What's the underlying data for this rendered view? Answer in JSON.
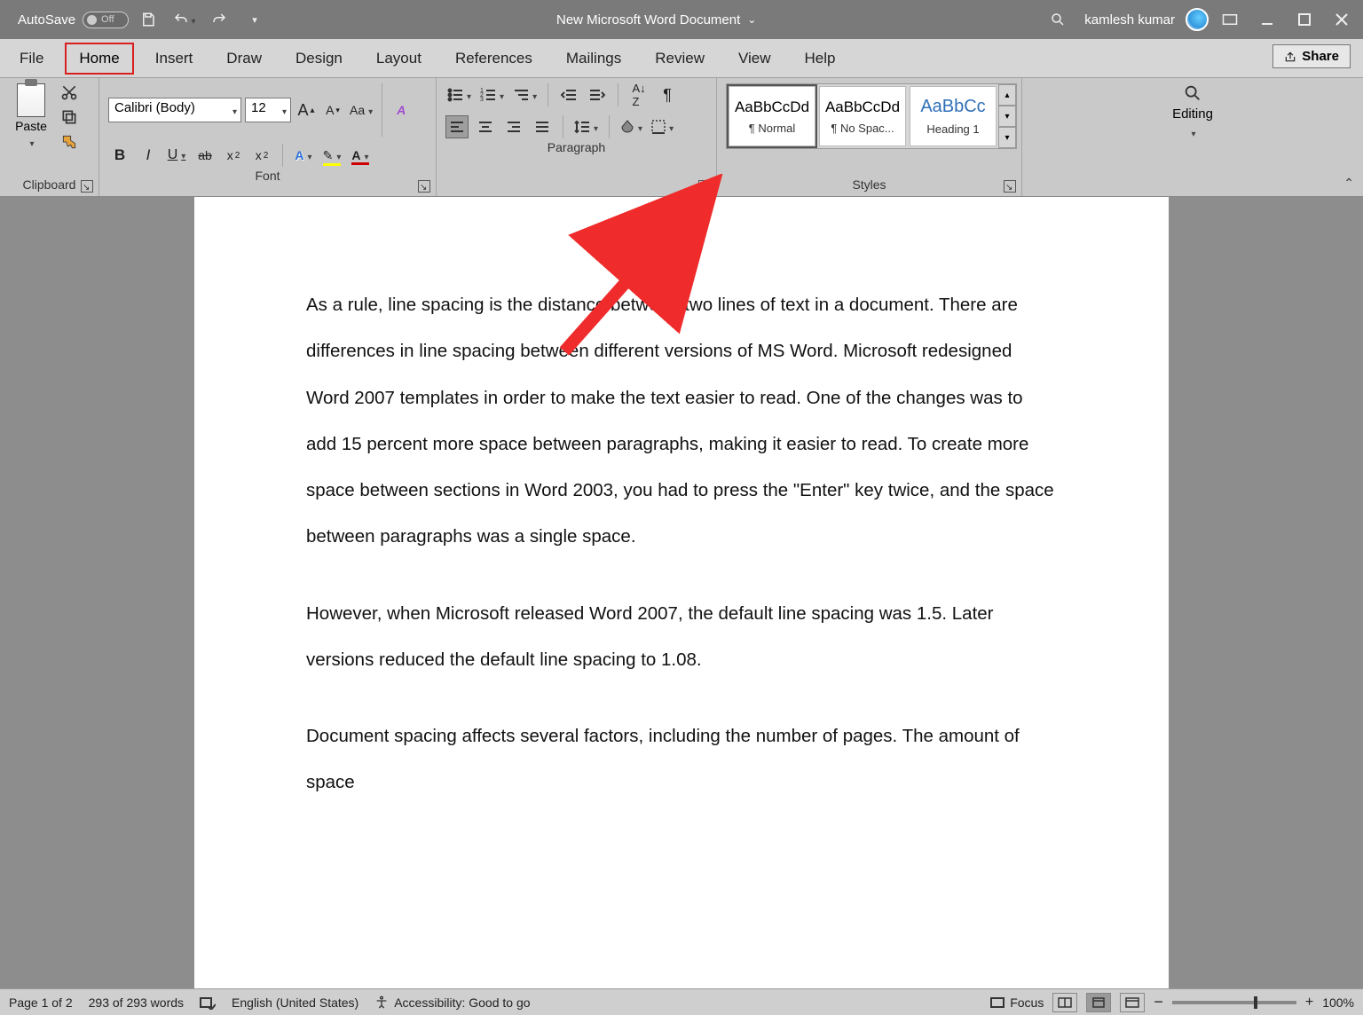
{
  "titleBar": {
    "autosave_label": "AutoSave",
    "autosave_state": "Off",
    "doc_title": "New Microsoft Word Document",
    "user_name": "kamlesh kumar"
  },
  "tabs": {
    "file": "File",
    "home": "Home",
    "insert": "Insert",
    "draw": "Draw",
    "design": "Design",
    "layout": "Layout",
    "references": "References",
    "mailings": "Mailings",
    "review": "Review",
    "view": "View",
    "help": "Help",
    "share": "Share"
  },
  "ribbon": {
    "clipboard": {
      "label": "Clipboard",
      "paste": "Paste"
    },
    "font": {
      "label": "Font",
      "font_name": "Calibri (Body)",
      "font_size": "12"
    },
    "paragraph": {
      "label": "Paragraph"
    },
    "styles": {
      "label": "Styles",
      "items": [
        {
          "sample": "AaBbCcDd",
          "name": "¶ Normal"
        },
        {
          "sample": "AaBbCcDd",
          "name": "¶ No Spac..."
        },
        {
          "sample": "AaBbCc",
          "name": "Heading 1"
        }
      ]
    },
    "editing": {
      "label": "Editing"
    }
  },
  "document": {
    "p1": "As a rule, line spacing is the distance between two lines of text in a document. There are differences in line spacing between different versions of MS Word. Microsoft redesigned Word 2007 templates in order to make the text easier to read. One of the changes was to add 15 percent more space between paragraphs, making it easier to read. To create more space between sections in Word 2003, you had to press the \"Enter\" key twice, and the space between paragraphs was a single space.",
    "p2": "However, when Microsoft released Word 2007, the default line spacing was 1.5. Later versions reduced the default line spacing to 1.08.",
    "p3": "Document spacing affects several factors, including the number of pages. The amount of space"
  },
  "status": {
    "page": "Page 1 of 2",
    "words": "293 of 293 words",
    "language": "English (United States)",
    "accessibility": "Accessibility: Good to go",
    "focus": "Focus",
    "zoom": "100%"
  }
}
